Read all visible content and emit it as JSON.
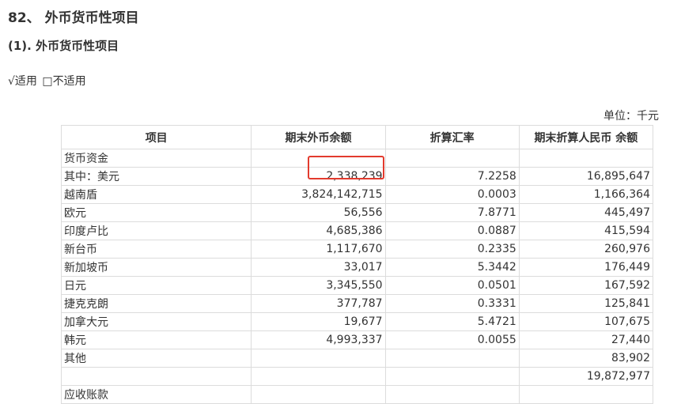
{
  "section_title": "82、 外币货币性项目",
  "subsection_title": "(1). 外币货币性项目",
  "applicability": {
    "applicable": "√适用",
    "not_applicable": "□不适用"
  },
  "unit_label": "单位：千元",
  "table": {
    "headers": [
      "项目",
      "期末外币余额",
      "折算汇率",
      "期末折算人民币 余额"
    ],
    "rows": [
      {
        "item": "货币资金",
        "foreign": "",
        "rate": "",
        "rmb": "",
        "indent": false
      },
      {
        "item": "其中：美元",
        "foreign": "2,338,239",
        "rate": "7.2258",
        "rmb": "16,895,647",
        "indent": false
      },
      {
        "item": "越南盾",
        "foreign": "3,824,142,715",
        "rate": "0.0003",
        "rmb": "1,166,364",
        "indent": true
      },
      {
        "item": "欧元",
        "foreign": "56,556",
        "rate": "7.8771",
        "rmb": "445,497",
        "indent": true
      },
      {
        "item": "印度卢比",
        "foreign": "4,685,386",
        "rate": "0.0887",
        "rmb": "415,594",
        "indent": true
      },
      {
        "item": "新台币",
        "foreign": "1,117,670",
        "rate": "0.2335",
        "rmb": "260,976",
        "indent": true
      },
      {
        "item": "新加坡币",
        "foreign": "33,017",
        "rate": "5.3442",
        "rmb": "176,449",
        "indent": true
      },
      {
        "item": "日元",
        "foreign": "3,345,550",
        "rate": "0.0501",
        "rmb": "167,592",
        "indent": true
      },
      {
        "item": "捷克克朗",
        "foreign": "377,787",
        "rate": "0.3331",
        "rmb": "125,841",
        "indent": true
      },
      {
        "item": "加拿大元",
        "foreign": "19,677",
        "rate": "5.4721",
        "rmb": "107,675",
        "indent": true
      },
      {
        "item": "韩元",
        "foreign": "4,993,337",
        "rate": "0.0055",
        "rmb": "27,440",
        "indent": true
      },
      {
        "item": "其他",
        "foreign": "",
        "rate": "",
        "rmb": "83,902",
        "indent": true
      },
      {
        "item": "",
        "foreign": "",
        "rate": "",
        "rmb": "19,872,977",
        "indent": false
      },
      {
        "item": "应收账款",
        "foreign": "",
        "rate": "",
        "rmb": "",
        "indent": false
      }
    ]
  },
  "highlight_color": "#e33b2e"
}
